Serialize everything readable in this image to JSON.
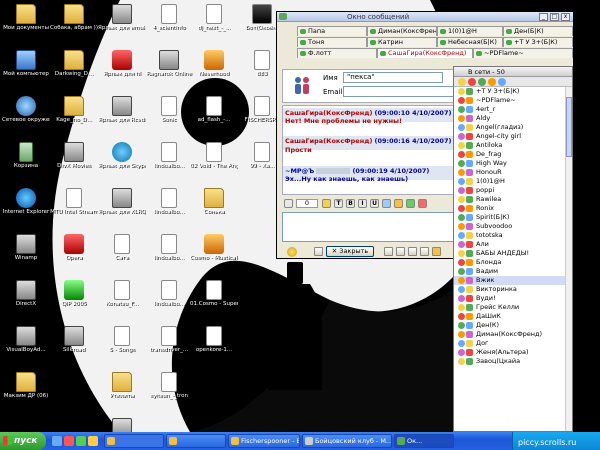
{
  "desktop_icons": [
    {
      "label": "Мои документы",
      "type": "folder"
    },
    {
      "label": "Мой компьютер",
      "type": "pc"
    },
    {
      "label": "Сетевое окружение",
      "type": "net"
    },
    {
      "label": "Корзина",
      "type": "trash"
    },
    {
      "label": "Internet Explorer",
      "type": "ie"
    },
    {
      "label": "Winamp",
      "type": "app"
    },
    {
      "label": "DirectX",
      "type": "app"
    },
    {
      "label": "VisualBoyAd...",
      "type": "app"
    },
    {
      "label": "Макзим ДР (06)",
      "type": "folder"
    },
    {
      "label": "Собака, абрам )))",
      "type": "folder"
    },
    {
      "label": "Darkwing_D...",
      "type": "folder"
    },
    {
      "label": "Kage_no_D...",
      "type": "folder"
    },
    {
      "label": "DivX Movies",
      "type": "app"
    },
    {
      "label": "MTU Intel Stream",
      "type": "doc"
    },
    {
      "label": "Opera",
      "type": "red"
    },
    {
      "label": "QIP 2005",
      "type": "green"
    },
    {
      "label": "Silkroad",
      "type": "app"
    },
    {
      "label": "Ярлык для emule",
      "type": "app"
    },
    {
      "label": "Ярлык для hl",
      "type": "red"
    },
    {
      "label": "Ярлык для RcvdFile",
      "type": "app"
    },
    {
      "label": "Ярлык для Skype",
      "type": "sky"
    },
    {
      "label": "Ярлык для XLRQ?",
      "type": "app"
    },
    {
      "label": "Сага",
      "type": "doc"
    },
    {
      "label": "Konatsu_F...",
      "type": "doc"
    },
    {
      "label": "S - Songs",
      "type": "doc"
    },
    {
      "label": "Утилиты",
      "type": "folder"
    },
    {
      "label": "Ultima Online",
      "type": "app"
    },
    {
      "label": "4_scientinfo",
      "type": "doc"
    },
    {
      "label": "Ragnarok Online",
      "type": "app"
    },
    {
      "label": "Sonic",
      "type": "doc"
    },
    {
      "label": "lindoalbo...",
      "type": "doc"
    },
    {
      "label": "lindoalbo...",
      "type": "doc"
    },
    {
      "label": "lindoalbo...",
      "type": "doc"
    },
    {
      "label": "lindoalbo...",
      "type": "doc"
    },
    {
      "label": "transdriver_...",
      "type": "doc"
    },
    {
      "label": "synsun_-_tron",
      "type": "doc"
    },
    {
      "label": "dj_next_-_...",
      "type": "doc"
    },
    {
      "label": "Neverhood",
      "type": "orange"
    },
    {
      "label": "ad_flash_-...",
      "type": "doc"
    },
    {
      "label": "02 Void - The Angry Brigа...",
      "type": "doc"
    },
    {
      "label": "Сонька",
      "type": "folder"
    },
    {
      "label": "Cosmo - Mustical Pol...",
      "type": "orange"
    },
    {
      "label": "01.Cosmo - Super Fu...",
      "type": "doc"
    },
    {
      "label": "openkore-1...",
      "type": "doc"
    },
    {
      "label": "Бот(Окоём)",
      "type": "dark"
    },
    {
      "label": "883",
      "type": "doc"
    },
    {
      "label": "FISCHERSP...",
      "type": "doc"
    },
    {
      "label": "99 - Ха...",
      "type": "doc"
    }
  ],
  "window": {
    "title": "Окно сообщений",
    "tabs_row1": [
      "Папа",
      "Диман(КоксФренд)",
      "1(0)1@Н",
      "Ден(Б|К)"
    ],
    "tabs_row2": [
      "Тоня",
      "Катрин",
      "Небесная(Б|К)",
      "+Т У З+(Б|К)"
    ],
    "tabs_row3": [
      "Ф.лотт",
      "СашаГира(КоксФренд)",
      "~PDFlame~"
    ],
    "name_label": "Имя",
    "name_value": "\"пекса\"",
    "email_label": "Email",
    "messages": [
      {
        "head": "СашаГира(КоксФренд)",
        "time": "(09:00:10 4/10/2007)",
        "text": "Нет! Мне проблемы не нужны!",
        "side": "b"
      },
      {
        "head": "СашаГира(КоксФренд)",
        "time": "(09:00:16 4/10/2007)",
        "text": "Прости",
        "side": "b"
      },
      {
        "head": "~МР@Ъ",
        "time": "(09:00:19 4/10/2007)",
        "text": "Эх...Ну как знаешь, как знаешь)",
        "side": "a"
      }
    ],
    "toolbar_counter": "0",
    "close_label": "Закрыть"
  },
  "contact_list": {
    "header": "В сети - 50",
    "contacts": [
      "+Т У З+(Б|К)",
      "~PDFlame~",
      "4ert_r",
      "Aldy",
      "Angel(гладиз)",
      "Angel-city girl",
      "Antiloka",
      "De_frag",
      "High Way",
      "HonouR",
      "1(0)1@Н",
      "poppi",
      "Rawilea",
      "Ronix",
      "Spirit(Б|К)",
      "Subvoodoo",
      "tototska",
      "Али",
      "БАБЫ АНДЕДЫ!",
      "Блонда",
      "Вадим",
      "Вжик",
      "Викторинка",
      "Вуди!",
      "Грейс Келли",
      "ДаШиК",
      "Ден(К)",
      "Диман(КоксФренд)",
      "Дог",
      "Женя(Альтера)",
      "Завоц(Цкайа"
    ],
    "selected": "Вжик"
  },
  "taskbar": {
    "start": "пуск",
    "tasks": [
      "Fischerspooner - Em...",
      "Бойцовский клуб - М...",
      "Ок..."
    ],
    "watermark": "piccy.scrolls.ru"
  }
}
